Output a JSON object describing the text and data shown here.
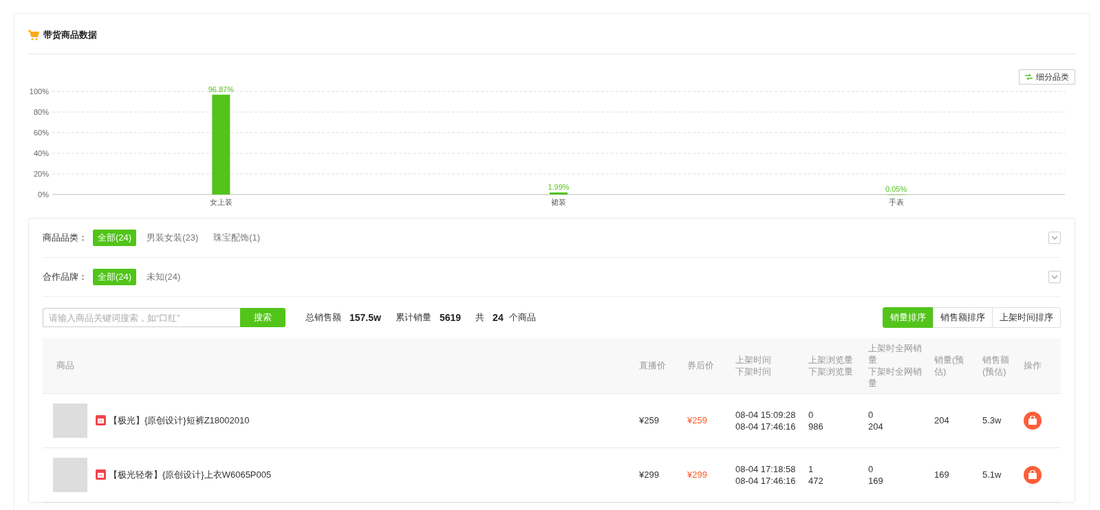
{
  "panel": {
    "title": "带货商品数据"
  },
  "chart": {
    "toggle_button": "细分品类",
    "chart_data": {
      "type": "bar",
      "grid": true,
      "categories": [
        "女上装",
        "裙装",
        "手表"
      ],
      "values": [
        96.87,
        1.99,
        0.05
      ],
      "ylim": [
        0,
        100
      ],
      "yticks": [
        {
          "value": 0,
          "label": "0%"
        },
        {
          "value": 20,
          "label": "20%"
        },
        {
          "value": 40,
          "label": "40%"
        },
        {
          "value": 60,
          "label": "60%"
        },
        {
          "value": 80,
          "label": "80%"
        },
        {
          "value": 100,
          "label": "100%"
        }
      ],
      "value_labels": [
        "96.87%",
        "1.99%",
        "0.05%"
      ]
    }
  },
  "filters": [
    {
      "label": "商品品类：",
      "options": [
        {
          "text": "全部(24)",
          "selected": true
        },
        {
          "text": "男装女装(23)",
          "selected": false
        },
        {
          "text": "珠宝配饰(1)",
          "selected": false
        }
      ]
    },
    {
      "label": "合作品牌：",
      "options": [
        {
          "text": "全部(24)",
          "selected": true
        },
        {
          "text": "未知(24)",
          "selected": false
        }
      ]
    }
  ],
  "search": {
    "placeholder": "请输入商品关键词搜索，如“口红”",
    "button": "搜索"
  },
  "stats": [
    {
      "label": "总销售额",
      "value": "157.5w"
    },
    {
      "label": "累计销量",
      "value": "5619"
    }
  ],
  "total": {
    "prefix": "共",
    "count": "24",
    "suffix": "个商品"
  },
  "sort_buttons": [
    {
      "label": "销量排序",
      "selected": true
    },
    {
      "label": "销售额排序",
      "selected": false
    },
    {
      "label": "上架时间排序",
      "selected": false
    }
  ],
  "table": {
    "columns": [
      {
        "lines": [
          "商品"
        ]
      },
      {
        "lines": [
          "直播价"
        ]
      },
      {
        "lines": [
          "券后价"
        ]
      },
      {
        "lines": [
          "上架时间",
          "下架时间"
        ]
      },
      {
        "lines": [
          "上架浏览量",
          "下架浏览量"
        ]
      },
      {
        "lines": [
          "上架时全网销量",
          "下架时全网销量"
        ]
      },
      {
        "lines": [
          "销量(预估)"
        ]
      },
      {
        "lines": [
          "销售额(预估)"
        ]
      },
      {
        "lines": [
          "操作"
        ]
      }
    ],
    "rows": [
      {
        "name": "【极光】{原创设计}短裤Z18002010",
        "live_price": "¥259",
        "coupon_price": "¥259",
        "listed_time": "08-04 15:09:28",
        "delisted_time": "08-04 17:46:16",
        "views_listed": "0",
        "views_delisted": "986",
        "sales_listed": "0",
        "sales_delisted": "204",
        "sales": "204",
        "revenue": "5.3w"
      },
      {
        "name": "【极光轻奢】{原创设计}上衣W6065P005",
        "live_price": "¥299",
        "coupon_price": "¥299",
        "listed_time": "08-04 17:18:58",
        "delisted_time": "08-04 17:46:16",
        "views_listed": "1",
        "views_delisted": "472",
        "sales_listed": "0",
        "sales_delisted": "169",
        "sales": "169",
        "revenue": "5.1w"
      }
    ]
  }
}
